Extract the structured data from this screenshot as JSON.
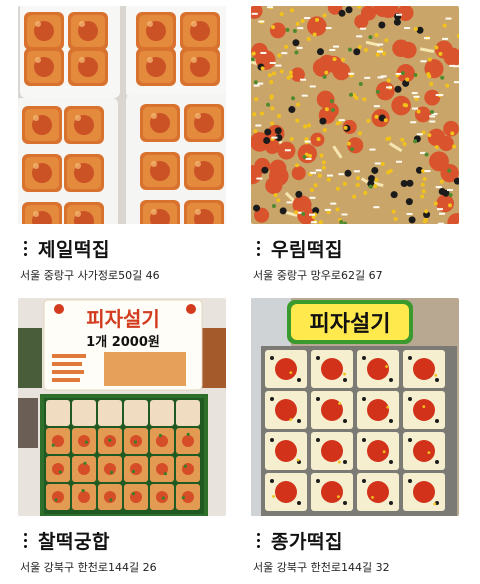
{
  "places": [
    {
      "name": "제일떡집",
      "address": "서울 중랑구 사가정로50길 46"
    },
    {
      "name": "우림떡집",
      "address": "서울 중랑구 망우로62길 67"
    },
    {
      "name": "찰떡궁합",
      "address": "서울 강북구 한천로144길 26"
    },
    {
      "name": "종가떡집",
      "address": "서울 강북구 한천로144길 32"
    }
  ],
  "photo_signs": {
    "sign_3_title": "피자설기",
    "sign_3_price": "1개 2000원",
    "sign_4_title": "피자설기"
  },
  "colors": {
    "pizza_orange": "#e07a3a",
    "sauce_red": "#d23b1e",
    "rice_cream": "#f3e3c4",
    "sign_green": "#3a9a2e"
  }
}
